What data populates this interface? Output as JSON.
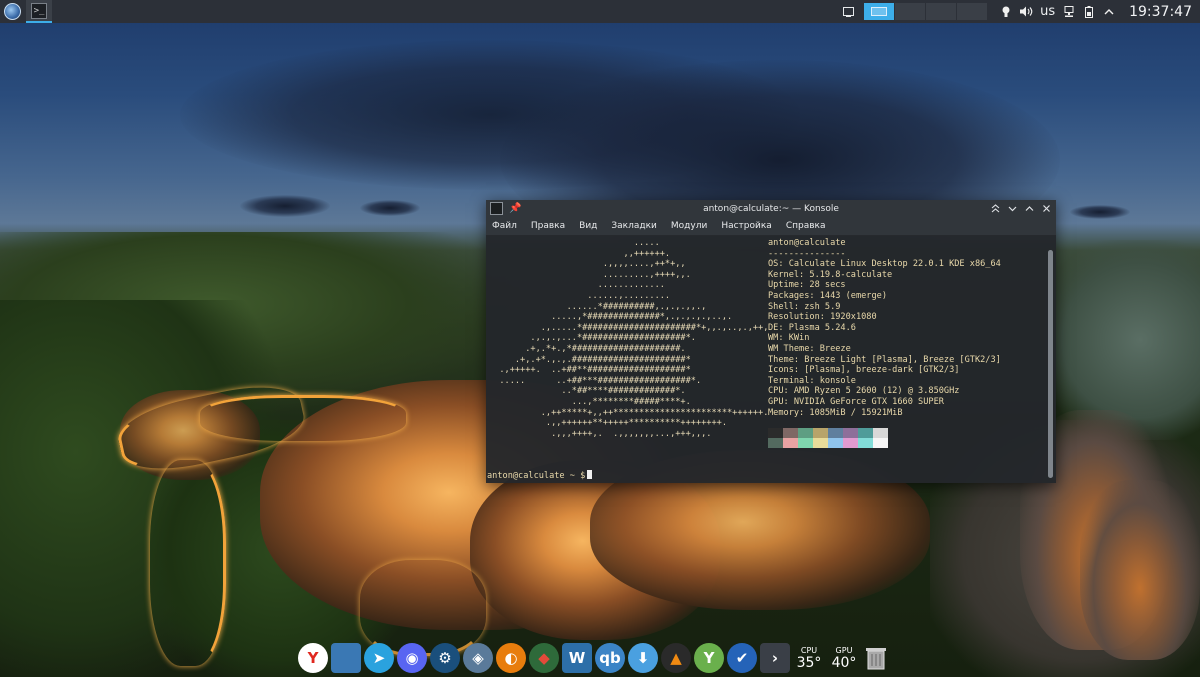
{
  "panel": {
    "launcher_icon": "calculate-linux-logo-icon",
    "task_icon": "konsole-terminal-icon",
    "tray_icons": [
      "show-desktop-icon",
      "notifications-bulb-icon",
      "volume-icon",
      "keyboard-layout",
      "network-icon",
      "battery-icon",
      "expand-tray-icon"
    ],
    "keyboard_layout": "us",
    "clock": "19:37:47",
    "virtual_desktops": 4,
    "active_desktop": 1
  },
  "window": {
    "title": "anton@calculate:~ — Konsole",
    "menu": [
      "Файл",
      "Правка",
      "Вид",
      "Закладки",
      "Модули",
      "Настройка",
      "Справка"
    ],
    "buttons": [
      "keep-above-icon",
      "minimize-icon",
      "maximize-icon",
      "close-icon"
    ]
  },
  "terminal": {
    "ascii_logo": [
      "                            .....",
      "                          ,,++++++.",
      "                      .,,,,....,++*+,,",
      "                      .........,++++,,.",
      "                     .............",
      "                   ......,.........",
      "               ......*##########,.,.,.,,.,",
      "            .....,*##############*,.,.,.,.,..,.",
      "          .,.....*######################*+,,.,..,.,++,",
      "        .,.,.,...*####################*.",
      "       .+,.*+.,*#####################.",
      "     .+,.+*.,.,.######################*",
      "  .,+++++.  ..+##**###################*",
      "  .....      ..+##***##################*.",
      "              ..*##****#############*.",
      "                ...,********#####****+.",
      "          .,++*****+,,++***********************++++++.",
      "           .,,++++++**+++++**********++++++++.",
      "            .,,,++++,.  .,,,,,,,...,+++,,,."
    ],
    "user_host": "anton@calculate",
    "separator": "---------------",
    "info": [
      {
        "key": "OS",
        "value": "Calculate Linux Desktop 22.0.1 KDE x86_64"
      },
      {
        "key": "Kernel",
        "value": "5.19.8-calculate"
      },
      {
        "key": "Uptime",
        "value": "28 secs"
      },
      {
        "key": "Packages",
        "value": "1443 (emerge)"
      },
      {
        "key": "Shell",
        "value": "zsh 5.9"
      },
      {
        "key": "Resolution",
        "value": "1920x1080"
      },
      {
        "key": "DE",
        "value": "Plasma 5.24.6"
      },
      {
        "key": "WM",
        "value": "KWin"
      },
      {
        "key": "WM Theme",
        "value": "Breeze"
      },
      {
        "key": "Theme",
        "value": "Breeze Light [Plasma], Breeze [GTK2/3]"
      },
      {
        "key": "Icons",
        "value": "[Plasma], breeze-dark [GTK2/3]"
      },
      {
        "key": "Terminal",
        "value": "konsole"
      },
      {
        "key": "CPU",
        "value": "AMD Ryzen 5 2600 (12) @ 3.850GHz"
      },
      {
        "key": "GPU",
        "value": "NVIDIA GeForce GTX 1660 SUPER"
      },
      {
        "key": "Memory",
        "value": "1085MiB / 15921MiB"
      }
    ],
    "palette_top": [
      "#2b2b2b",
      "#7f6865",
      "#5e9e82",
      "#b8a46a",
      "#5f7f9e",
      "#8e6f9a",
      "#4f9c9a",
      "#d8d8d8"
    ],
    "palette_bottom": [
      "#536a5f",
      "#e8a3a3",
      "#7fd6ae",
      "#e9dc9a",
      "#8fc4ec",
      "#e29bd1",
      "#82dcd8",
      "#f6f6f6"
    ],
    "prompt": "anton@calculate ~ $"
  },
  "dock": {
    "apps": [
      {
        "name": "yandex-browser-icon",
        "glyph": "Y",
        "color": "#ffffff",
        "fg": "#e0281f"
      },
      {
        "name": "file-manager-icon",
        "glyph": "",
        "color": "#3a78b4",
        "fg": "#ffffff"
      },
      {
        "name": "telegram-icon",
        "glyph": "➤",
        "color": "#2aa2de",
        "fg": "#ffffff"
      },
      {
        "name": "discord-icon",
        "glyph": "◉",
        "color": "#5865f2",
        "fg": "#ffffff"
      },
      {
        "name": "steam-icon",
        "glyph": "⚙",
        "color": "#1a4f7c",
        "fg": "#ffffff"
      },
      {
        "name": "app-vpn-icon",
        "glyph": "◈",
        "color": "#5a7a9a",
        "fg": "#ffffff"
      },
      {
        "name": "blender-icon",
        "glyph": "◐",
        "color": "#e87d0d",
        "fg": "#ffffff"
      },
      {
        "name": "kde-games-icon",
        "glyph": "◆",
        "color": "#2e6a3a",
        "fg": "#e24a3a"
      },
      {
        "name": "libreoffice-writer-icon",
        "glyph": "W",
        "color": "#2d6fa8",
        "fg": "#ffffff"
      },
      {
        "name": "qbittorrent-icon",
        "glyph": "qb",
        "color": "#3b84c6",
        "fg": "#ffffff"
      },
      {
        "name": "downloader-icon",
        "glyph": "⬇",
        "color": "#4aa0e0",
        "fg": "#ffffff"
      },
      {
        "name": "vlc-icon",
        "glyph": "▲",
        "color": "#2a2a2a",
        "fg": "#f08a12"
      },
      {
        "name": "kde-connect-icon",
        "glyph": "Y",
        "color": "#6ab04c",
        "fg": "#ffffff"
      },
      {
        "name": "system-update-icon",
        "glyph": "✔",
        "color": "#2563b8",
        "fg": "#ffffff"
      },
      {
        "name": "konsole-icon",
        "glyph": "›",
        "color": "#3a3f47",
        "fg": "#ffffff"
      }
    ],
    "cpu_label": "CPU",
    "cpu_temp": "35°",
    "gpu_label": "GPU",
    "gpu_temp": "40°",
    "trash_icon": "trash-icon"
  }
}
